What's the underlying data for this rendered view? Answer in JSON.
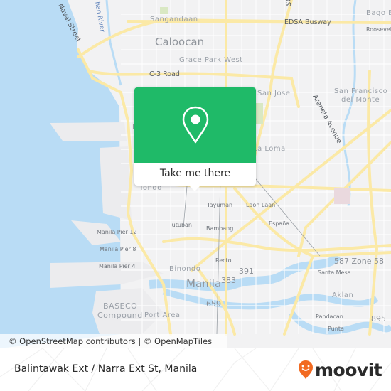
{
  "map": {
    "labels": {
      "naval_street": "Naval Street",
      "river": "han River",
      "sangandaan": "Sangandaan",
      "caloocan": "Caloocan",
      "grace_park_west": "Grace Park West",
      "c3_road": "C-3 Road",
      "edsa_busway": "EDSA Busway",
      "sky": "Sky",
      "bago_bantay": "Bago B",
      "roosevelt": "Roosevel",
      "san_jose": "San Jose",
      "san_francisco": "San Francisco",
      "del_monte": "del Monte",
      "araneta_avenue": "Araneta Avenue",
      "la_loma": "La Loma",
      "tondo": "Tondo",
      "tayuman": "Tayuman",
      "laon_laan": "Laon Laan",
      "espana": "España",
      "tutuban": "Tutuban",
      "bambang": "Bambang",
      "manila_pier_12": "Manila Pier 12",
      "manila_pier_8": "Manila Pier 8",
      "manila_pier_4": "Manila Pier 4",
      "binondo": "Binondo",
      "recto": "Recto",
      "r391": "391",
      "r383": "383",
      "manila": "Manila",
      "zone_58": "587 Zone 58",
      "santa_mesa": "Santa Mesa",
      "aklan": "Aklan",
      "baseco": "BASECO",
      "compound": "Compound",
      "port_area": "Port Area",
      "r659": "659",
      "pandacan": "Pandacan",
      "punta": "Punta",
      "r895": "895",
      "e_label": "E"
    },
    "attribution": "© OpenStreetMap contributors | © OpenMapTiles",
    "colors": {
      "water": "#b9dcf5",
      "land": "#f2f2f3",
      "major_road": "#fbe9a6",
      "minor_road": "#ffffff"
    }
  },
  "popup": {
    "icon": "map-pin-icon",
    "cta_label": "Take me there",
    "accent": "#1fba68"
  },
  "footer": {
    "stop_title": "Balintawak Ext / Narra Ext St, Manila",
    "brand": "moovit",
    "brand_color": "#f26a21"
  }
}
